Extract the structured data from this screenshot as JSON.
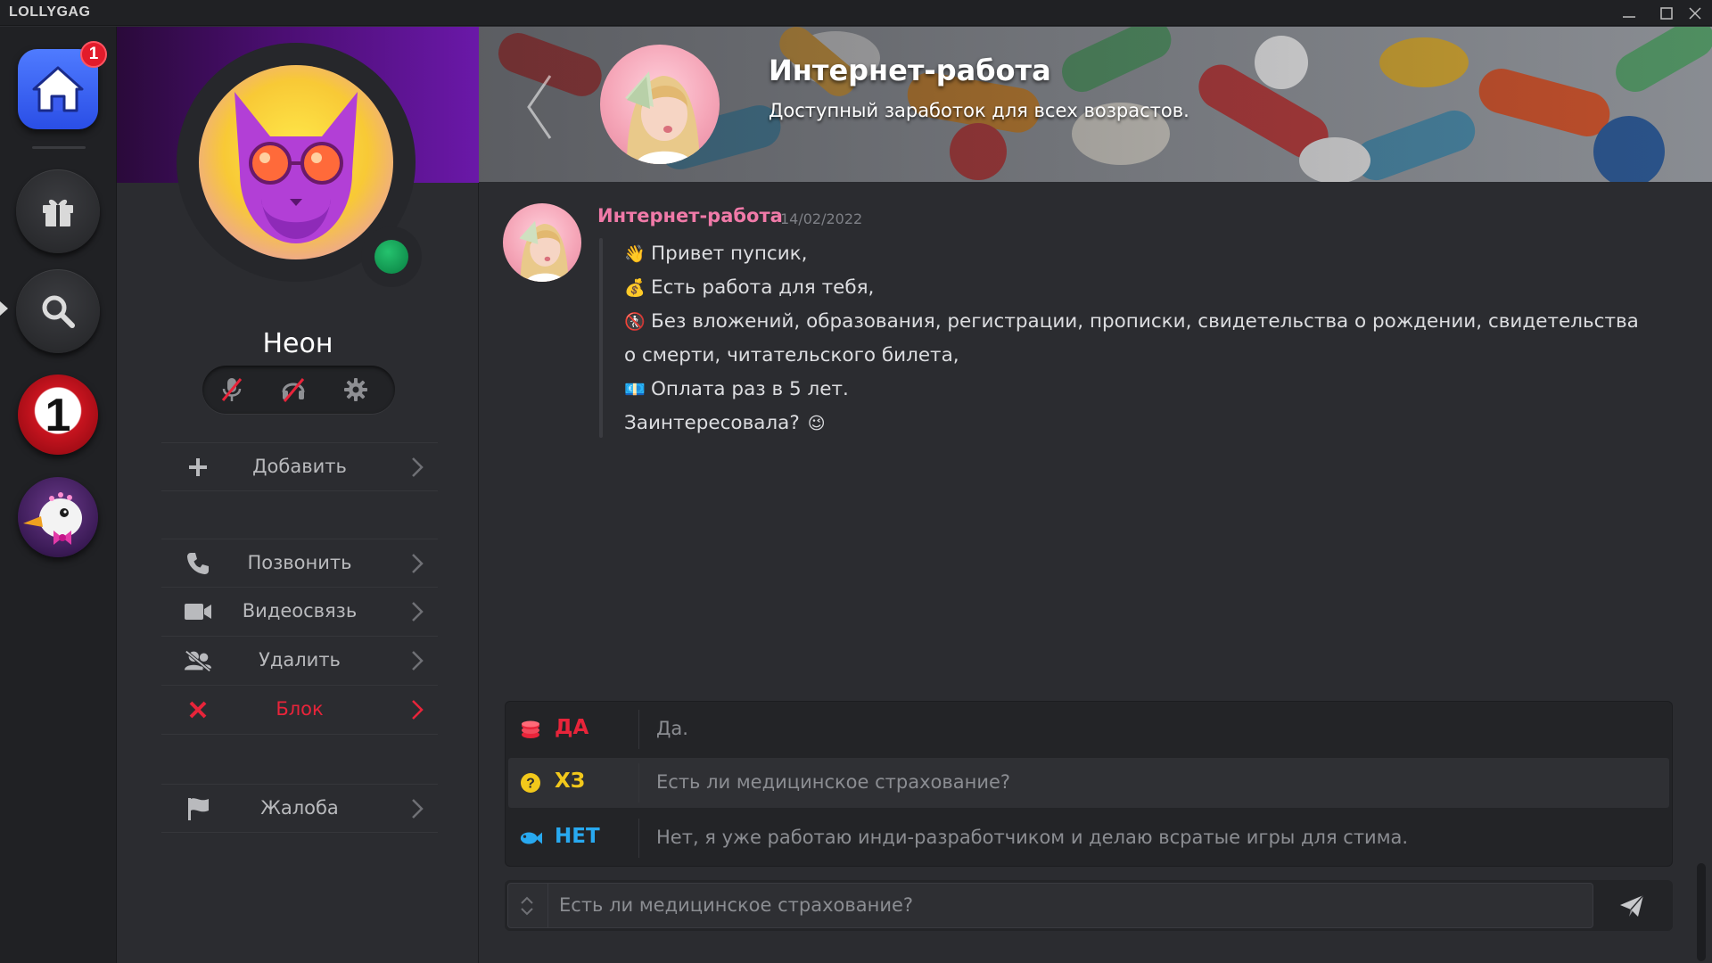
{
  "window": {
    "app_title": "LOLLYGAG"
  },
  "rail": {
    "home_badge_count": "1",
    "number_button_label": "1",
    "items": [
      {
        "name": "home",
        "icon": "house-icon"
      },
      {
        "name": "gifts",
        "icon": "gift-icon"
      },
      {
        "name": "search",
        "icon": "search-icon"
      },
      {
        "name": "number-one",
        "icon": "number-one-badge"
      },
      {
        "name": "duck-avatar",
        "icon": "duck-avatar-image"
      }
    ]
  },
  "profile": {
    "username": "Неон",
    "status": "online",
    "status_color": "#1aa85c",
    "controls": [
      "mute-mic-icon",
      "mute-headphones-icon",
      "gear-icon"
    ],
    "menu": [
      {
        "label": "Добавить",
        "icon": "plus-icon"
      },
      {
        "label": "Позвонить",
        "icon": "phone-icon"
      },
      {
        "label": "Видеосвязь",
        "icon": "video-camera-icon"
      },
      {
        "label": "Удалить",
        "icon": "remove-user-icon"
      },
      {
        "label": "Блок",
        "icon": "close-x-icon",
        "color": "#e8243a"
      },
      {
        "label": "Жалоба",
        "icon": "flag-icon"
      }
    ]
  },
  "chat": {
    "title": "Интернет-работа",
    "subtitle": "Доступный заработок для всех возрастов.",
    "message": {
      "author": "Интернет-работа",
      "author_color": "#f07aa8",
      "date": "14/02/2022",
      "lines": [
        {
          "emoji": "👋",
          "text": "Привет пупсик,"
        },
        {
          "emoji": "💰",
          "text": "Есть работа для тебя,"
        },
        {
          "emoji": "🚷",
          "text": "Без вложений, образования, регистрации, прописки, свидетельства о рождении, свидетельства о смерти, читательского билета,"
        },
        {
          "emoji": "💶",
          "text": "Оплата раз в 5 лет."
        },
        {
          "emoji": "😉",
          "text": "Заинтересовала?"
        }
      ]
    },
    "choices": [
      {
        "key": "ДА",
        "text": "Да.",
        "color": "#e8243a",
        "icon": "coins-stack-icon"
      },
      {
        "key": "ХЗ",
        "text": "Есть ли медицинское страхование?",
        "color": "#f2c81b",
        "icon": "question-circle-icon",
        "selected": true
      },
      {
        "key": "НЕТ",
        "text": "Нет, я уже работаю инди-разработчиком и делаю всратые игры для стима.",
        "color": "#28a9f0",
        "icon": "fish-icon"
      }
    ],
    "input": {
      "value": "Есть ли медицинское страхование?"
    }
  }
}
